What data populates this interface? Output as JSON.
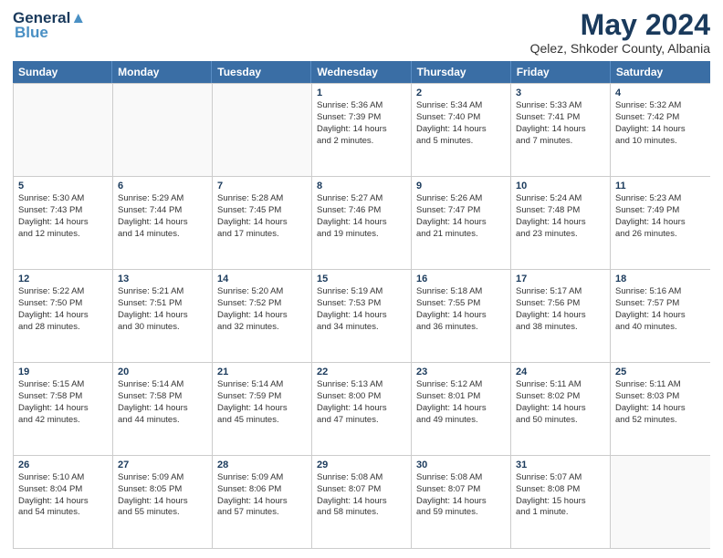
{
  "header": {
    "logo_general": "General",
    "logo_blue": "Blue",
    "month_title": "May 2024",
    "subtitle": "Qelez, Shkoder County, Albania"
  },
  "calendar": {
    "days_of_week": [
      "Sunday",
      "Monday",
      "Tuesday",
      "Wednesday",
      "Thursday",
      "Friday",
      "Saturday"
    ],
    "weeks": [
      [
        {
          "day": "",
          "info": ""
        },
        {
          "day": "",
          "info": ""
        },
        {
          "day": "",
          "info": ""
        },
        {
          "day": "1",
          "info": "Sunrise: 5:36 AM\nSunset: 7:39 PM\nDaylight: 14 hours\nand 2 minutes."
        },
        {
          "day": "2",
          "info": "Sunrise: 5:34 AM\nSunset: 7:40 PM\nDaylight: 14 hours\nand 5 minutes."
        },
        {
          "day": "3",
          "info": "Sunrise: 5:33 AM\nSunset: 7:41 PM\nDaylight: 14 hours\nand 7 minutes."
        },
        {
          "day": "4",
          "info": "Sunrise: 5:32 AM\nSunset: 7:42 PM\nDaylight: 14 hours\nand 10 minutes."
        }
      ],
      [
        {
          "day": "5",
          "info": "Sunrise: 5:30 AM\nSunset: 7:43 PM\nDaylight: 14 hours\nand 12 minutes."
        },
        {
          "day": "6",
          "info": "Sunrise: 5:29 AM\nSunset: 7:44 PM\nDaylight: 14 hours\nand 14 minutes."
        },
        {
          "day": "7",
          "info": "Sunrise: 5:28 AM\nSunset: 7:45 PM\nDaylight: 14 hours\nand 17 minutes."
        },
        {
          "day": "8",
          "info": "Sunrise: 5:27 AM\nSunset: 7:46 PM\nDaylight: 14 hours\nand 19 minutes."
        },
        {
          "day": "9",
          "info": "Sunrise: 5:26 AM\nSunset: 7:47 PM\nDaylight: 14 hours\nand 21 minutes."
        },
        {
          "day": "10",
          "info": "Sunrise: 5:24 AM\nSunset: 7:48 PM\nDaylight: 14 hours\nand 23 minutes."
        },
        {
          "day": "11",
          "info": "Sunrise: 5:23 AM\nSunset: 7:49 PM\nDaylight: 14 hours\nand 26 minutes."
        }
      ],
      [
        {
          "day": "12",
          "info": "Sunrise: 5:22 AM\nSunset: 7:50 PM\nDaylight: 14 hours\nand 28 minutes."
        },
        {
          "day": "13",
          "info": "Sunrise: 5:21 AM\nSunset: 7:51 PM\nDaylight: 14 hours\nand 30 minutes."
        },
        {
          "day": "14",
          "info": "Sunrise: 5:20 AM\nSunset: 7:52 PM\nDaylight: 14 hours\nand 32 minutes."
        },
        {
          "day": "15",
          "info": "Sunrise: 5:19 AM\nSunset: 7:53 PM\nDaylight: 14 hours\nand 34 minutes."
        },
        {
          "day": "16",
          "info": "Sunrise: 5:18 AM\nSunset: 7:55 PM\nDaylight: 14 hours\nand 36 minutes."
        },
        {
          "day": "17",
          "info": "Sunrise: 5:17 AM\nSunset: 7:56 PM\nDaylight: 14 hours\nand 38 minutes."
        },
        {
          "day": "18",
          "info": "Sunrise: 5:16 AM\nSunset: 7:57 PM\nDaylight: 14 hours\nand 40 minutes."
        }
      ],
      [
        {
          "day": "19",
          "info": "Sunrise: 5:15 AM\nSunset: 7:58 PM\nDaylight: 14 hours\nand 42 minutes."
        },
        {
          "day": "20",
          "info": "Sunrise: 5:14 AM\nSunset: 7:58 PM\nDaylight: 14 hours\nand 44 minutes."
        },
        {
          "day": "21",
          "info": "Sunrise: 5:14 AM\nSunset: 7:59 PM\nDaylight: 14 hours\nand 45 minutes."
        },
        {
          "day": "22",
          "info": "Sunrise: 5:13 AM\nSunset: 8:00 PM\nDaylight: 14 hours\nand 47 minutes."
        },
        {
          "day": "23",
          "info": "Sunrise: 5:12 AM\nSunset: 8:01 PM\nDaylight: 14 hours\nand 49 minutes."
        },
        {
          "day": "24",
          "info": "Sunrise: 5:11 AM\nSunset: 8:02 PM\nDaylight: 14 hours\nand 50 minutes."
        },
        {
          "day": "25",
          "info": "Sunrise: 5:11 AM\nSunset: 8:03 PM\nDaylight: 14 hours\nand 52 minutes."
        }
      ],
      [
        {
          "day": "26",
          "info": "Sunrise: 5:10 AM\nSunset: 8:04 PM\nDaylight: 14 hours\nand 54 minutes."
        },
        {
          "day": "27",
          "info": "Sunrise: 5:09 AM\nSunset: 8:05 PM\nDaylight: 14 hours\nand 55 minutes."
        },
        {
          "day": "28",
          "info": "Sunrise: 5:09 AM\nSunset: 8:06 PM\nDaylight: 14 hours\nand 57 minutes."
        },
        {
          "day": "29",
          "info": "Sunrise: 5:08 AM\nSunset: 8:07 PM\nDaylight: 14 hours\nand 58 minutes."
        },
        {
          "day": "30",
          "info": "Sunrise: 5:08 AM\nSunset: 8:07 PM\nDaylight: 14 hours\nand 59 minutes."
        },
        {
          "day": "31",
          "info": "Sunrise: 5:07 AM\nSunset: 8:08 PM\nDaylight: 15 hours\nand 1 minute."
        },
        {
          "day": "",
          "info": ""
        }
      ]
    ]
  }
}
